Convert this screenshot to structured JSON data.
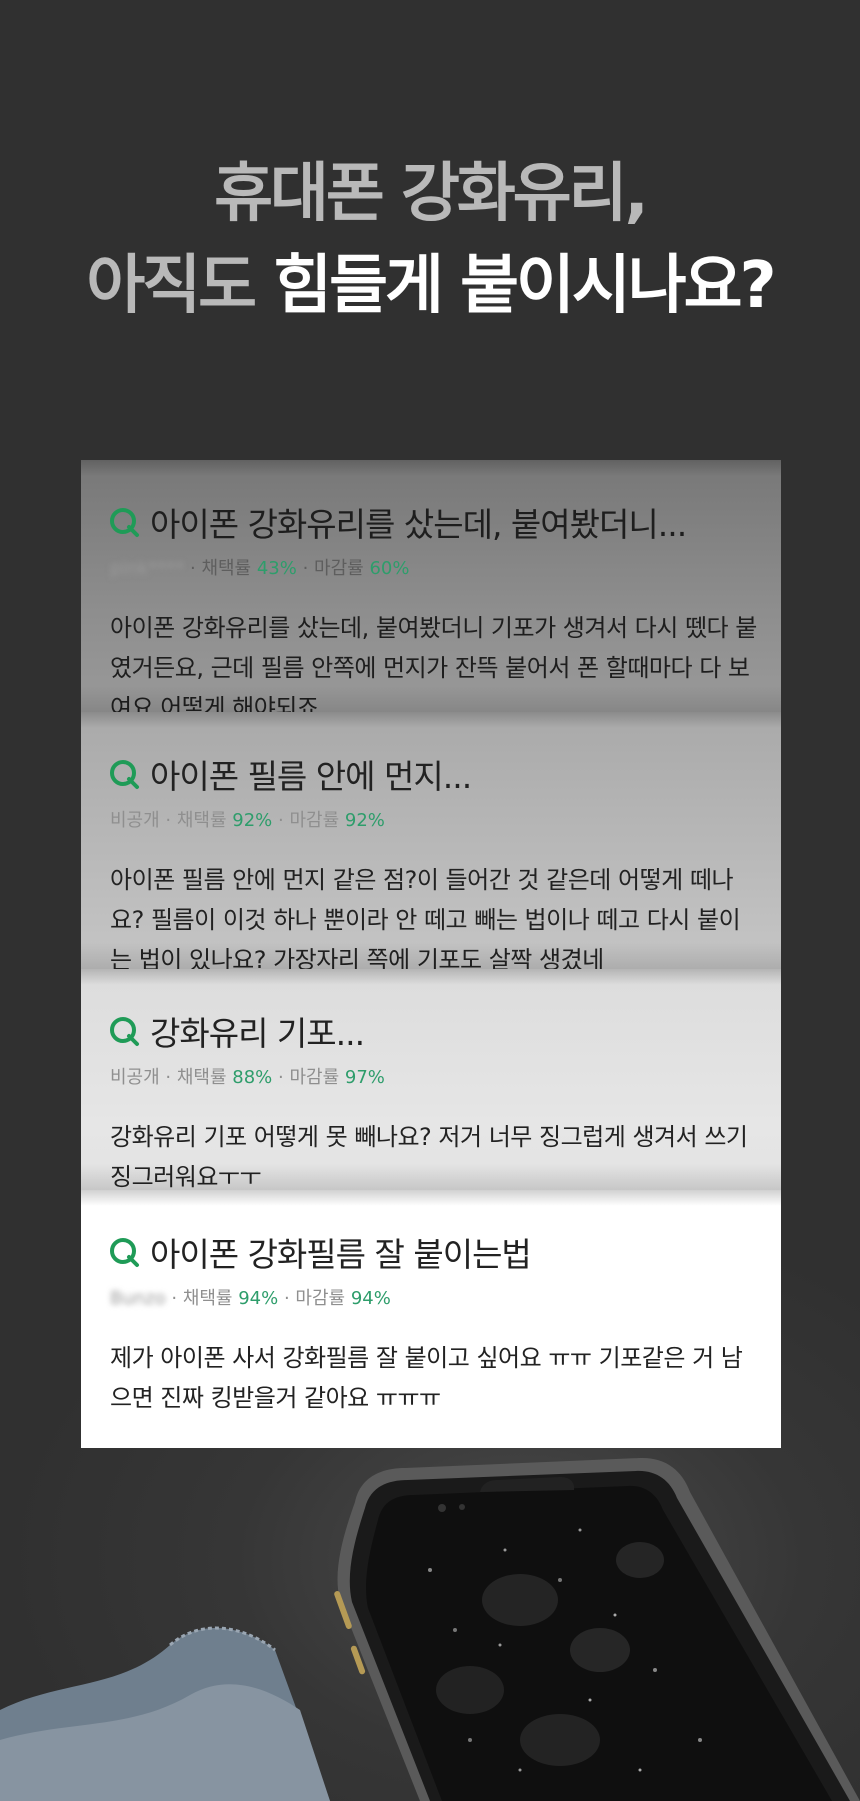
{
  "headline": {
    "line1": "휴대폰 강화유리,",
    "line2_dim": "아직도 ",
    "line2_bright": "힘들게 붙이시나요?"
  },
  "cards": [
    {
      "title": "아이폰 강화유리를 샀는데, 붙여봤더니...",
      "author": "pink****",
      "adopt_label": "채택률",
      "adopt_rate": "43%",
      "close_label": "마감률",
      "close_rate": "60%",
      "body": "아이폰 강화유리를 샀는데, 붙여봤더니 기포가 생겨서 다시 뗐다 붙였거든요, 근데 필름 안쪽에 먼지가 잔뜩 붙어서 폰 할때마다 다 보여요 어떻게 해야되죠"
    },
    {
      "title": "아이폰 필름 안에 먼지...",
      "author": "비공개",
      "adopt_label": "채택률",
      "adopt_rate": "92%",
      "close_label": "마감률",
      "close_rate": "92%",
      "body": "아이폰 필름 안에 먼지 같은 점?이 들어간 것 같은데 어떻게 떼나요? 필름이 이것 하나 뿐이라 안 떼고 빼는 법이나 떼고 다시 붙이는 법이 있나요? 가장자리 쪽에 기포도 살짝 생겼네"
    },
    {
      "title": "강화유리 기포...",
      "author": "비공개",
      "adopt_label": "채택률",
      "adopt_rate": "88%",
      "close_label": "마감률",
      "close_rate": "97%",
      "body": "강화유리 기포 어떻게 못 빼나요? 저거 너무 징그럽게 생겨서 쓰기 징그러워요ㅜㅜ"
    },
    {
      "title": "아이폰 강화필름 잘 붙이는법",
      "author": "Bunzo",
      "adopt_label": "채택률",
      "adopt_rate": "94%",
      "close_label": "마감률",
      "close_rate": "94%",
      "body": "제가 아이폰 사서 강화필름 잘 붙이고 싶어요 ㅠㅠ 기포같은 거 남으면 진짜 킹받을거 같아요 ㅠㅠㅠ"
    }
  ],
  "colors": {
    "background": "#303030",
    "accent_green": "#2e9d6b",
    "headline_dim": "#b9b9b9",
    "headline_bright": "#ffffff"
  },
  "icons": [
    "q-icon",
    "smartphone-illustration",
    "cleaning-cloth-illustration"
  ]
}
